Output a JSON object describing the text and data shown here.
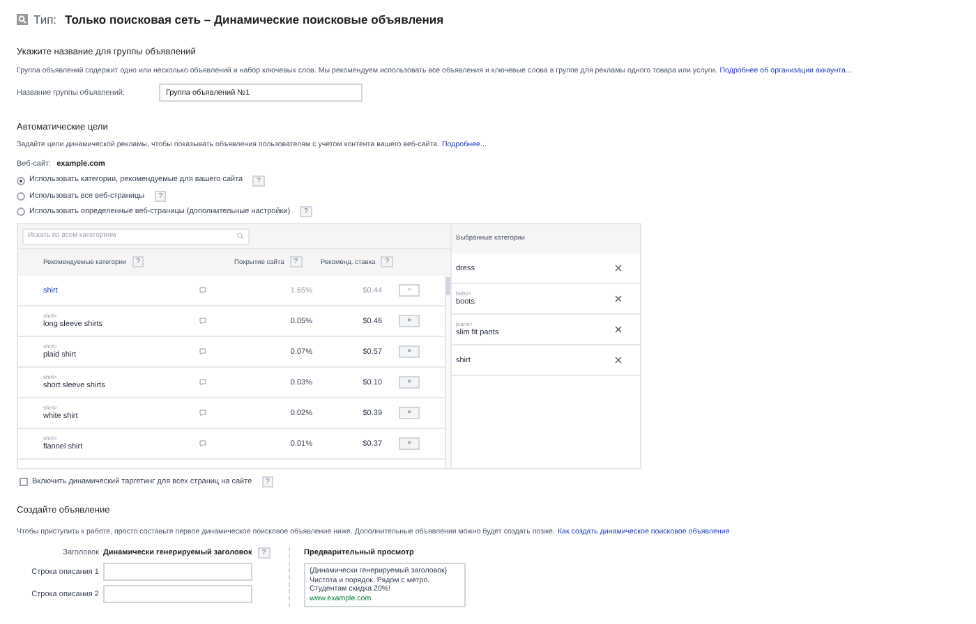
{
  "header": {
    "label": "Тип:",
    "title": "Только поисковая сеть – Динамические поисковые объявления"
  },
  "ad_group": {
    "heading": "Укажите название для группы объявлений",
    "description": "Группа объявлений содержит одно или несколько объявлений и набор ключевых слов. Мы рекомендуем использовать все объявления и ключевые слова в группе для рекламы одного товара или услуги.",
    "link": "Подробнее об организации аккаунта...",
    "field_label": "Название группы объявлений:",
    "field_value": "Группа объявлений №1"
  },
  "targets": {
    "heading": "Автоматические цели",
    "description": "Задайте цели динамической рекламы, чтобы показывать объявления пользователям с учетом контента вашего веб-сайта.",
    "link": "Подробнее...",
    "site_label": "Веб-сайт:",
    "site_value": "example.com",
    "options": [
      {
        "label": "Использовать категории, рекомендуемые для вашего сайта",
        "help": "?",
        "selected": true
      },
      {
        "label": "Использовать все веб-страницы",
        "help": "?",
        "selected": false
      },
      {
        "label": "Использовать определенные веб-страницы (дополнительные настройки)",
        "help": "?",
        "selected": false
      }
    ]
  },
  "categories": {
    "search_placeholder": "Искать по всем категориям",
    "columns": [
      {
        "label": "Рекомендуемые категории",
        "help": "?"
      },
      {
        "label": "Покрытие сайта",
        "help": "?"
      },
      {
        "label": "Рекоменд. ставка",
        "help": "?"
      }
    ],
    "rows": [
      {
        "name": "shirt",
        "coverage": "1.65%",
        "bid": "$0.44",
        "add": "»",
        "disabled": true
      },
      {
        "parent": "shirt>",
        "name": "long sleeve shirts",
        "coverage": "0.05%",
        "bid": "$0.46",
        "add": "»",
        "disabled": false
      },
      {
        "parent": "shirt>",
        "name": "plaid shirt",
        "coverage": "0.07%",
        "bid": "$0.57",
        "add": "»",
        "disabled": false
      },
      {
        "parent": "shirt>",
        "name": "short sleeve shirts",
        "coverage": "0.03%",
        "bid": "$0.10",
        "add": "»",
        "disabled": false
      },
      {
        "parent": "shirt>",
        "name": "white shirt",
        "coverage": "0.02%",
        "bid": "$0.39",
        "add": "»",
        "disabled": false
      },
      {
        "parent": "shirt>",
        "name": "flannel shirt",
        "coverage": "0.01%",
        "bid": "$0.37",
        "add": "»",
        "disabled": false
      }
    ],
    "selected_heading": "Выбранные категории",
    "selected": [
      {
        "name": "dress"
      },
      {
        "parent": "baby>",
        "name": "boots"
      },
      {
        "parent": "jeans>",
        "name": "slim fit pants"
      },
      {
        "name": "shirt"
      }
    ]
  },
  "all_pages": {
    "label": "Включить динамический таргетинг для всех страниц на сайте",
    "help": "?",
    "checked": false
  },
  "create_ad": {
    "heading": "Создайте объявление",
    "description": "Чтобы приступить к работе, просто составьте первое динамическое поисковое объявление ниже. Дополнительные объявления можно будет создать позже.",
    "link": "Как создать динамическое поисковое объявление",
    "headline_label": "Заголовок",
    "headline_value": "Динамически генерируемый заголовок",
    "headline_help": "?",
    "fields": [
      {
        "label": "Строка описания 1"
      },
      {
        "label": "Строка описания 2"
      }
    ],
    "preview_heading": "Предварительный просмотр",
    "preview": {
      "headline": "{Динамически генерируемый заголовок}",
      "line1": "Чистота и порядок. Рядом с метро.",
      "line2": "Студентам скидка 20%!",
      "url": "www.example.com"
    }
  }
}
